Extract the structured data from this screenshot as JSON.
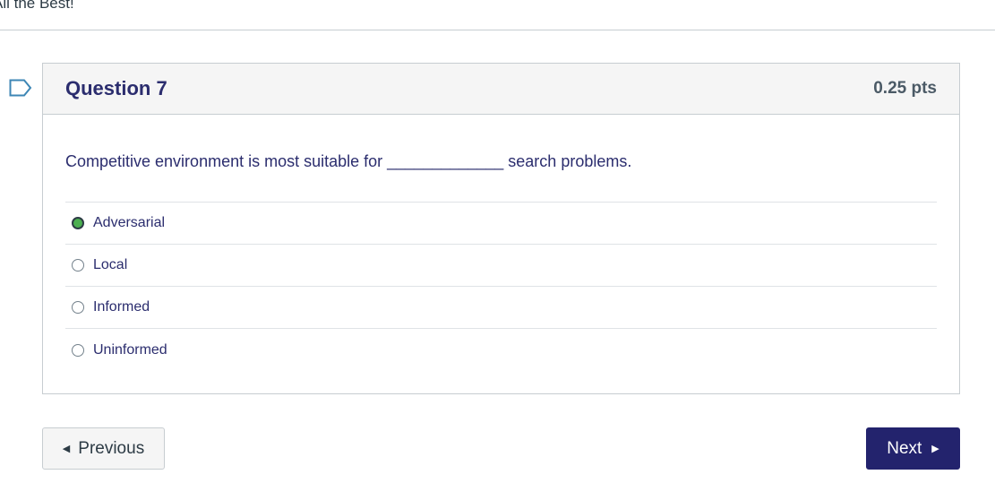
{
  "header": {
    "top_text": "All the Best!"
  },
  "question": {
    "title": "Question 7",
    "points": "0.25 pts",
    "text": "Competitive environment is most suitable for _____________ search problems.",
    "answers": [
      {
        "label": "Adversarial",
        "selected": true
      },
      {
        "label": "Local",
        "selected": false
      },
      {
        "label": "Informed",
        "selected": false
      },
      {
        "label": "Uninformed",
        "selected": false
      }
    ]
  },
  "nav": {
    "previous_label": "Previous",
    "next_label": "Next"
  },
  "colors": {
    "title": "#2b2d6e",
    "next_button": "#23236d",
    "selected_radio": "#4caf50",
    "flag": "#3d86b5"
  },
  "icons": {
    "flag": "bookmark-flag-icon",
    "prev": "caret-left-icon",
    "next": "caret-right-icon"
  }
}
